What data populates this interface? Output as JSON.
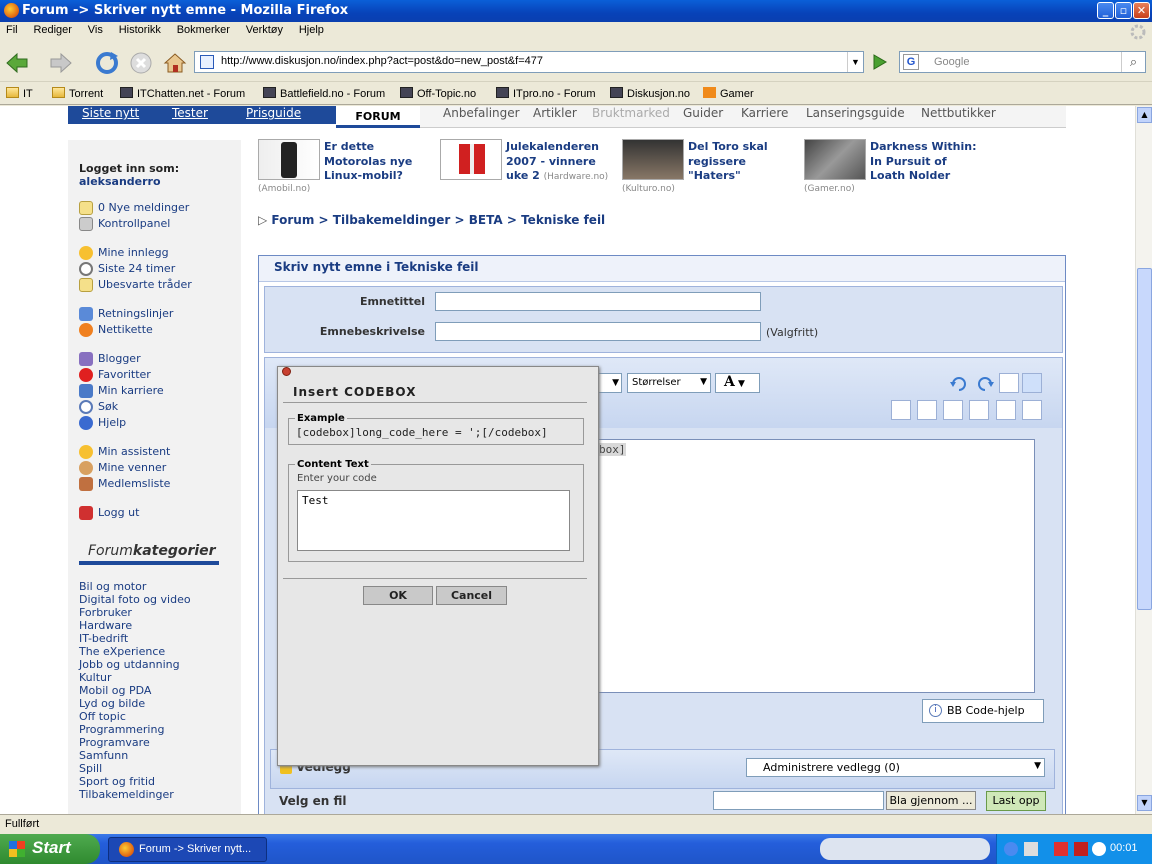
{
  "window": {
    "title": "Forum -> Skriver nytt emne - Mozilla Firefox"
  },
  "menu": [
    "Fil",
    "Rediger",
    "Vis",
    "Historikk",
    "Bokmerker",
    "Verktøy",
    "Hjelp"
  ],
  "navigation": {
    "url": "http://www.diskusjon.no/index.php?act=post&do=new_post&f=477",
    "search_placeholder": "Google"
  },
  "bookmarks": [
    "IT",
    "Torrent",
    "ITChatten.net - Forum",
    "Battlefield.no - Forum",
    "Off-Topic.no",
    "ITpro.no - Forum",
    "Diskusjon.no",
    "Gamer"
  ],
  "site_tabs": {
    "left": [
      "Siste nytt",
      "Tester",
      "Prisguide"
    ],
    "active": "FORUM",
    "right": [
      "Anbefalinger",
      "Artikler",
      "Bruktmarked",
      "Guider",
      "Karriere",
      "Lanseringsguide",
      "Nettbutikker"
    ]
  },
  "news": [
    {
      "title": "Er dette Motorolas nye Linux-mobil?",
      "lines": [
        "Er dette",
        "Motorolas nye",
        "Linux-mobil?"
      ],
      "source": "(Amobil.no)"
    },
    {
      "title": "Julekalenderen 2007 - vinnere uke 2",
      "lines": [
        "Julekalenderen",
        "2007 - vinnere",
        "uke 2"
      ],
      "source": "(Hardware.no)"
    },
    {
      "title": "Del Toro skal regissere \"Haters\"",
      "lines": [
        "Del Toro skal",
        "regissere",
        "\"Haters\""
      ],
      "source": "(Kulturo.no)"
    },
    {
      "title": "Darkness Within: In Pursuit of Loath Nolder",
      "lines": [
        "Darkness Within:",
        "In Pursuit of",
        "Loath Nolder"
      ],
      "source": "(Gamer.no)"
    }
  ],
  "sidebar": {
    "logged_in_label": "Logget inn som:",
    "username": "aleksanderro",
    "links": [
      "0 Nye meldinger",
      "Kontrollpanel",
      "Mine innlegg",
      "Siste 24 timer",
      "Ubesvarte tråder",
      "Retningslinjer",
      "Nettikette",
      "Blogger",
      "Favoritter",
      "Min karriere",
      "Søk",
      "Hjelp",
      "Min assistent",
      "Mine venner",
      "Medlemsliste",
      "Logg ut"
    ],
    "categories_title_prefix": "Forum",
    "categories_title_suffix": "kategorier",
    "categories": [
      "Bil og motor",
      "Digital foto og video",
      "Forbruker",
      "Hardware",
      "IT-bedrift",
      "The eXperience",
      "Jobb og utdanning",
      "Kultur",
      "Mobil og PDA",
      "Lyd og bilde",
      "Off topic",
      "Programmering",
      "Programvare",
      "Samfunn",
      "Spill",
      "Sport og fritid",
      "Tilbakemeldinger"
    ]
  },
  "breadcrumb": {
    "marker": "▷",
    "items": [
      "Forum",
      "Tilbakemeldinger",
      "BETA",
      "Tekniske feil"
    ],
    "separator": ">"
  },
  "form": {
    "header": "Skriv nytt emne i Tekniske feil",
    "title_label": "Emnetittel",
    "desc_label": "Emnebeskrivelse",
    "desc_hint": "(Valgfritt)",
    "sizes_label": "Størrelser",
    "editor_visible_text": "box]",
    "bbcode_help": "BB Code-hjelp",
    "attachments_label": "Vedlegg",
    "attachments_select": "Administrere vedlegg (0)",
    "choose_file_label": "Velg en fil",
    "browse_button": "Bla gjennom ...",
    "upload_button": "Last opp"
  },
  "dialog": {
    "title": "Insert CODEBOX",
    "example_legend": "Example",
    "example_text": "[codebox]long_code_here = ';[/codebox]",
    "content_legend": "Content Text",
    "content_hint": "Enter your code",
    "content_value": "Test",
    "ok": "OK",
    "cancel": "Cancel"
  },
  "statusbar": {
    "text": "Fullført"
  },
  "taskbar": {
    "start": "Start",
    "task": "Forum -> Skriver nytt...",
    "clock": "00:01"
  }
}
